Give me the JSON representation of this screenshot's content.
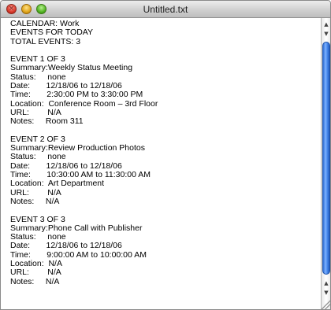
{
  "window": {
    "title": "Untitled.txt"
  },
  "document": {
    "lines": [
      "CALENDAR: Work",
      "EVENTS FOR TODAY",
      "TOTAL EVENTS: 3",
      "",
      "EVENT 1 OF 3",
      "Summary:Weekly Status Meeting",
      "Status:     none",
      "Date:       12/18/06 to 12/18/06",
      "Time:       2:30:00 PM to 3:30:00 PM",
      "Location:  Conference Room – 3rd Floor",
      "URL:        N/A",
      "Notes:     Room 311",
      "",
      "EVENT 2 OF 3",
      "Summary:Review Production Photos",
      "Status:     none",
      "Date:       12/18/06 to 12/18/06",
      "Time:       10:30:00 AM to 11:30:00 AM",
      "Location:  Art Department",
      "URL:        N/A",
      "Notes:     N/A",
      "",
      "EVENT 3 OF 3",
      "Summary:Phone Call with Publisher",
      "Status:     none",
      "Date:       12/18/06 to 12/18/06",
      "Time:       9:00:00 AM to 10:00:00 AM",
      "Location:  N/A",
      "URL:        N/A",
      "Notes:     N/A"
    ]
  },
  "icons": {
    "close": "close-icon",
    "minimize": "minimize-icon",
    "zoom": "zoom-icon",
    "scroll_up": "arrow-up-icon",
    "scroll_down": "arrow-down-icon",
    "resize": "resize-grip-icon"
  },
  "colors": {
    "close": "#d8382a",
    "minimize": "#e0a51b",
    "zoom": "#52b322",
    "scroll_thumb": "#4d8ef0"
  }
}
